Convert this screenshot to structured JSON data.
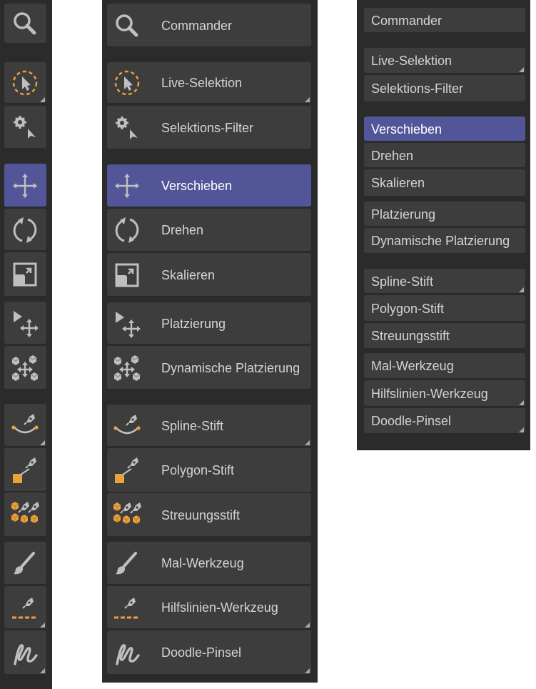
{
  "tools": [
    {
      "id": "commander",
      "label": "Commander",
      "icon": "search-icon"
    },
    {
      "id": "live-selektion",
      "label": "Live-Selektion",
      "icon": "live-selection-icon"
    },
    {
      "id": "selektions-filter",
      "label": "Selektions-Filter",
      "icon": "selection-filter-icon"
    },
    {
      "id": "verschieben",
      "label": "Verschieben",
      "icon": "move-icon",
      "active": true
    },
    {
      "id": "drehen",
      "label": "Drehen",
      "icon": "rotate-icon"
    },
    {
      "id": "skalieren",
      "label": "Skalieren",
      "icon": "scale-icon"
    },
    {
      "id": "platzierung",
      "label": "Platzierung",
      "icon": "placement-icon"
    },
    {
      "id": "dynamische-platzierung",
      "label": "Dynamische Platzierung",
      "icon": "dynamic-placement-icon"
    },
    {
      "id": "spline-stift",
      "label": "Spline-Stift",
      "icon": "spline-pen-icon"
    },
    {
      "id": "polygon-stift",
      "label": "Polygon-Stift",
      "icon": "polygon-pen-icon"
    },
    {
      "id": "streuungsstift",
      "label": "Streuungsstift",
      "icon": "scatter-pen-icon"
    },
    {
      "id": "mal-werkzeug",
      "label": "Mal-Werkzeug",
      "icon": "paint-brush-icon"
    },
    {
      "id": "hilfslinien-werkzeug",
      "label": "Hilfslinien-Werkzeug",
      "icon": "guide-pen-icon"
    },
    {
      "id": "doodle-pinsel",
      "label": "Doodle-Pinsel",
      "icon": "doodle-brush-icon"
    }
  ],
  "colors": {
    "panel_bg": "#2b2b2b",
    "button_bg": "#3d3d3d",
    "active_bg": "#525698",
    "icon_gray": "#bfbfbf",
    "icon_orange": "#e9a23b"
  }
}
